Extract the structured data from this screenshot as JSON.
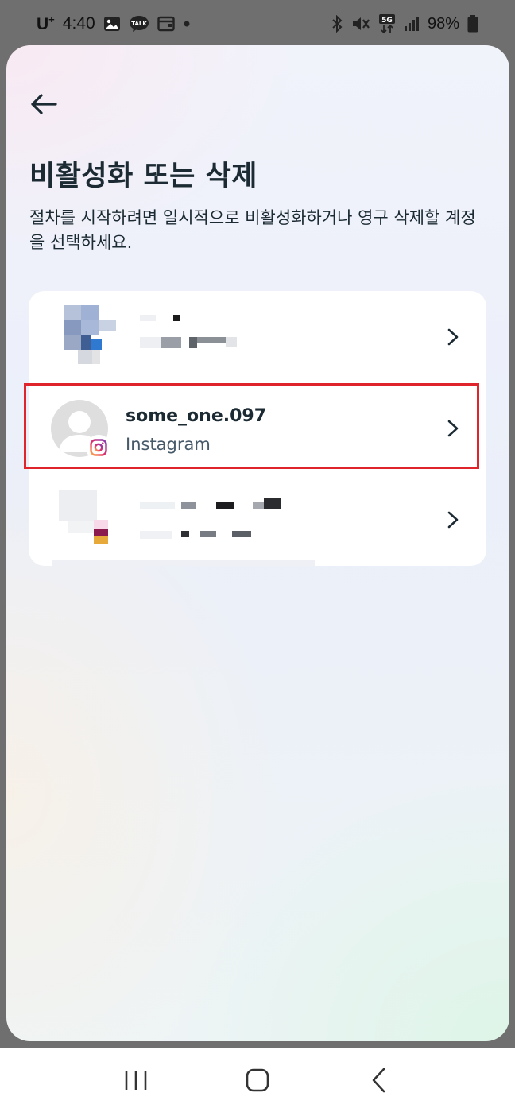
{
  "status_bar": {
    "carrier": "U",
    "carrier_sup": "+",
    "time": "4:40",
    "battery": "98%",
    "icons": [
      "gallery-icon",
      "talk-icon",
      "wallet-icon",
      "dot-icon",
      "bluetooth-icon",
      "mute-icon",
      "5g-icon",
      "signal-icon",
      "battery-icon"
    ]
  },
  "header": {
    "back_icon": "arrow-left-icon",
    "title": "비활성화 또는 삭제",
    "subtitle": "절차를 시작하려면 일시적으로 비활성화하거나 영구 삭제할 계정을 선택하세요."
  },
  "accounts": [
    {
      "username": "",
      "platform": "",
      "obscured": true
    },
    {
      "username": "some_one.097",
      "platform": "Instagram",
      "obscured": false,
      "badge_icon": "instagram-icon",
      "highlighted": true
    },
    {
      "username": "",
      "platform": "",
      "obscured": true
    }
  ],
  "nav_bar": {
    "icons": [
      "recents-icon",
      "home-icon",
      "back-icon"
    ]
  },
  "colors": {
    "highlight": "#e0242c",
    "text_primary": "#1c2b33",
    "text_secondary": "#465a69"
  }
}
